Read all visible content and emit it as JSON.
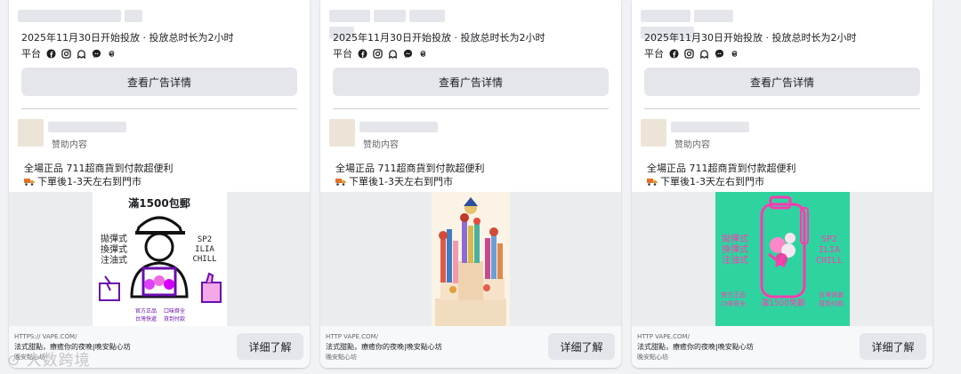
{
  "cards": [
    {
      "date_line": "2025年11月30日开始投放 · 投放总时长为2小时",
      "platform_label": "平台",
      "details_button": "查看广告详情",
      "sponsored": "赞助内容",
      "ad_text_1": "全場正品 711超商貨到付款超便利",
      "ad_text_2": "下單後1-3天左右到門市",
      "creative": {
        "top": "滿1500包郵",
        "left": [
          "拋彈式",
          "換彈式",
          "注油式"
        ],
        "right": [
          "SP2",
          "ILIA",
          "CHILL"
        ],
        "bottom_left": [
          "官方正品",
          "台灣快遞"
        ],
        "bottom_right": [
          "口味齊全",
          "貨到付款"
        ]
      },
      "url": "HTTPS://          VAPE.COM/",
      "footer_title": "法式甜點，療癒你的夜晚|晚安點心坊",
      "footer_sub": "晚安點心坊",
      "learn_more": "详细了解"
    },
    {
      "date_line": "2025年11月30日开始投放 · 投放总时长为2小时",
      "platform_label": "平台",
      "details_button": "查看广告详情",
      "sponsored": "赞助内容",
      "ad_text_1": "全場正品 711超商貨到付款超便利",
      "ad_text_2": "下單後1-3天左右到門市",
      "url": "HTTP          VAPE.COM/",
      "footer_title": "法式甜點，療癒你的夜晚|晚安點心坊",
      "footer_sub": "晚安點心坊",
      "learn_more": "详细了解"
    },
    {
      "date_line": "2025年11月30日开始投放 · 投放总时长为2小时",
      "platform_label": "平台",
      "details_button": "查看广告详情",
      "sponsored": "赞助内容",
      "ad_text_1": "全場正品 711超商貨到付款超便利",
      "ad_text_2": "下單後1-3天左右到門市",
      "creative": {
        "left": [
          "拋彈式",
          "換彈式",
          "注油式"
        ],
        "right": [
          "SP2",
          "ILIA",
          "CHILL"
        ],
        "bottom_left": [
          "官方正品",
          "口味齊全"
        ],
        "bottom_center": "滿1500免郵",
        "bottom_right": [
          "台灣快遞",
          "貨到付款"
        ]
      },
      "url": "HTTP          VAPE.COM/",
      "footer_title": "法式甜點，療癒你的夜晚|晚安點心坊",
      "footer_sub": "晚安點心坊",
      "learn_more": "详细了解"
    }
  ],
  "watermark": "大数跨境",
  "colors": {
    "background": "#f0f2f5",
    "card": "#ffffff",
    "button": "#e4e6eb",
    "creative1_accent": "#6a0dad",
    "creative3_bg": "#2fd3a0",
    "creative3_neon": "#ff3bb0"
  },
  "icons": [
    "facebook-icon",
    "instagram-icon",
    "audience-network-icon",
    "messenger-icon",
    "threads-icon",
    "truck-icon"
  ]
}
